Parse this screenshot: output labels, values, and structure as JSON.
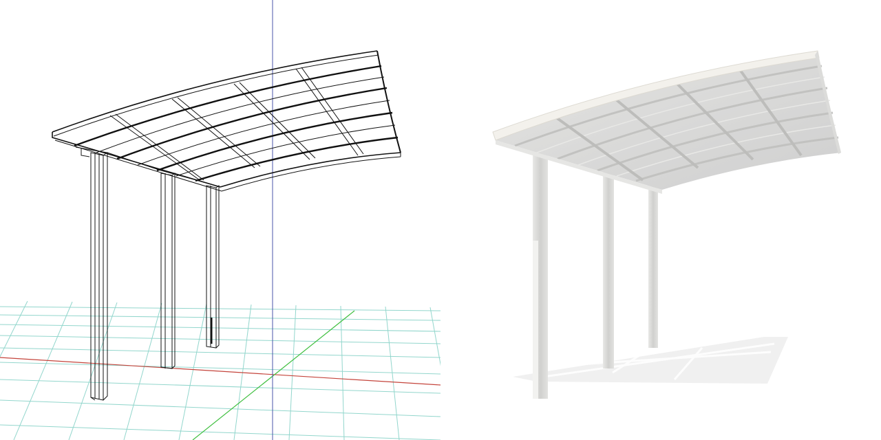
{
  "views": {
    "wireframe": {
      "style": "wireframe",
      "line_color": "#111111",
      "grid_color": "#7fcfc4",
      "x_axis_color": "#c4433a",
      "y_axis_color": "#3fbf3f",
      "z_axis_color": "#4a55a8",
      "background": "#ffffff"
    },
    "rendered": {
      "style": "shaded",
      "roof_color": "#d9d9d9",
      "frame_color": "#efefec",
      "post_color": "#d8d8d6",
      "shadow_color": "#eeeeee",
      "background": "#ffffff"
    }
  },
  "model": {
    "object": "carport",
    "posts": 3,
    "roof": "curved"
  }
}
